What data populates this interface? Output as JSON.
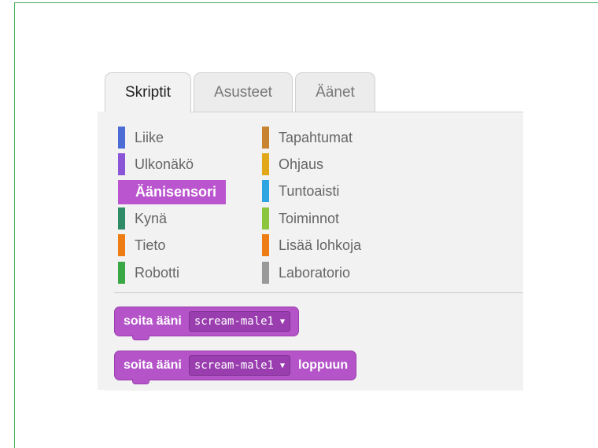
{
  "tabs": [
    {
      "label": "Skriptit",
      "active": true
    },
    {
      "label": "Asusteet",
      "active": false
    },
    {
      "label": "Äänet",
      "active": false
    }
  ],
  "categories_left": [
    {
      "label": "Liike",
      "color": "#4a6cd4"
    },
    {
      "label": "Ulkonäkö",
      "color": "#8a55d7"
    },
    {
      "label": "Äänisensori",
      "color": "#bb55cf",
      "selected": true
    },
    {
      "label": "Kynä",
      "color": "#2e8b66"
    },
    {
      "label": "Tieto",
      "color": "#ee7d16"
    },
    {
      "label": "Robotti",
      "color": "#3aa844"
    }
  ],
  "categories_right": [
    {
      "label": "Tapahtumat",
      "color": "#c88330"
    },
    {
      "label": "Ohjaus",
      "color": "#e1a91a"
    },
    {
      "label": "Tuntoaisti",
      "color": "#2ca5e2"
    },
    {
      "label": "Toiminnot",
      "color": "#8cc63f"
    },
    {
      "label": "Lisää lohkoja",
      "color": "#ee7d16"
    },
    {
      "label": "Laboratorio",
      "color": "#999999"
    }
  ],
  "blocks": [
    {
      "label": "soita ääni",
      "dropdown": "scream-male1",
      "trailing": ""
    },
    {
      "label": "soita ääni",
      "dropdown": "scream-male1",
      "trailing": "loppuun"
    }
  ],
  "dropdown_arrow": "▼",
  "colors": {
    "sound_block": "#b454c8",
    "accent_frame": "#3fae5a"
  }
}
